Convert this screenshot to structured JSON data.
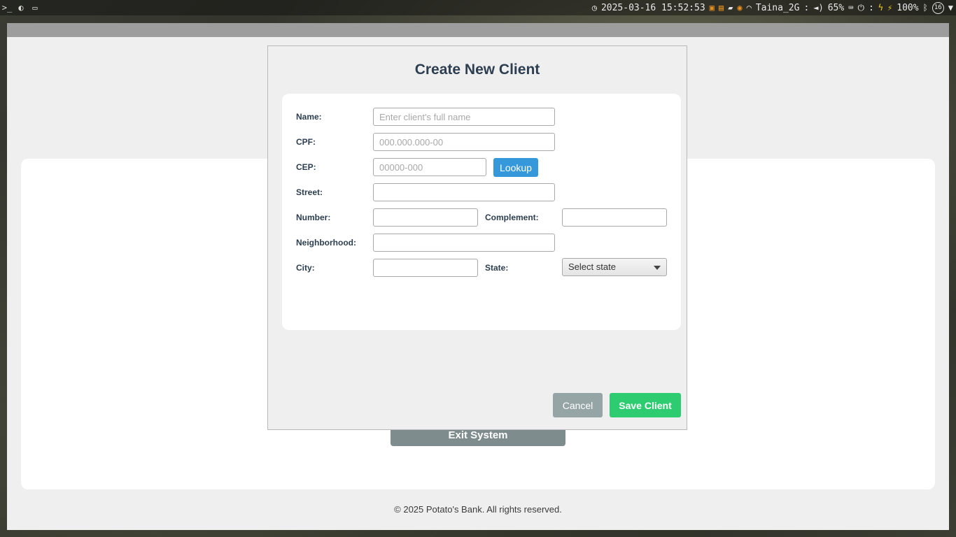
{
  "system_bar": {
    "clock_icon": "clock-icon",
    "datetime": "2025-03-16 15:52:53",
    "wifi_name": "Taina_2G",
    "wifi_separator": ":",
    "volume": "65%",
    "power_separator": ":",
    "battery": "100%",
    "notification_count": "16"
  },
  "app": {
    "exit_button_label": "Exit System",
    "footer": "© 2025 Potato's Bank. All rights reserved."
  },
  "dialog": {
    "title": "Create New Client",
    "fields": {
      "name": {
        "label": "Name:",
        "placeholder": "Enter client's full name"
      },
      "cpf": {
        "label": "CPF:",
        "placeholder": "000.000.000-00"
      },
      "cep": {
        "label": "CEP:",
        "placeholder": "00000-000"
      },
      "street": {
        "label": "Street:"
      },
      "number": {
        "label": "Number:"
      },
      "complement": {
        "label": "Complement:"
      },
      "neighborhood": {
        "label": "Neighborhood:"
      },
      "city": {
        "label": "City:"
      },
      "state": {
        "label": "State:",
        "selected": "Select state"
      }
    },
    "lookup_label": "Lookup",
    "cancel_label": "Cancel",
    "save_label": "Save Client"
  },
  "colors": {
    "title": "#2c3e50",
    "lookup": "#3498db",
    "cancel": "#95a5a6",
    "save": "#2ecc71",
    "exit": "#7f8c8d"
  }
}
